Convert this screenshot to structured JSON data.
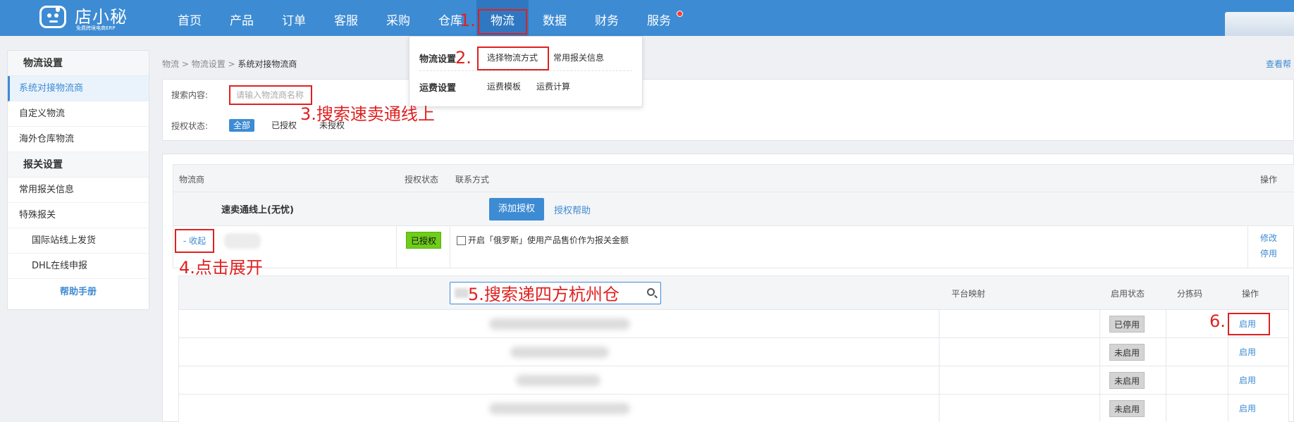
{
  "logo": {
    "title": "店小秘",
    "subtitle": "免费跨境电商ERP"
  },
  "nav": [
    {
      "label": "首页"
    },
    {
      "label": "产品"
    },
    {
      "label": "订单"
    },
    {
      "label": "客服"
    },
    {
      "label": "采购"
    },
    {
      "label": "仓库"
    },
    {
      "label": "物流",
      "active": true
    },
    {
      "label": "数据"
    },
    {
      "label": "财务"
    },
    {
      "label": "服务",
      "has_dot": true
    }
  ],
  "dropdown": {
    "group1_title": "物流设置",
    "group1_items": [
      "选择物流方式",
      "常用报关信息"
    ],
    "group2_title": "运费设置",
    "group2_items": [
      "运费模板",
      "运费计算"
    ]
  },
  "sidebar": {
    "section1": "物流设置",
    "items1": [
      "系统对接物流商",
      "自定义物流",
      "海外仓库物流"
    ],
    "section2": "报关设置",
    "items2": [
      "常用报关信息",
      "特殊报关"
    ],
    "sub_items": [
      "国际站线上发货",
      "DHL在线申报"
    ],
    "help": "帮助手册"
  },
  "breadcrumb": {
    "part1": "物流",
    "sep": " > ",
    "part2": "物流设置",
    "current": "系统对接物流商"
  },
  "help_link": "查看帮",
  "filter": {
    "search_label": "搜索内容:",
    "search_placeholder": "请输入物流商名称",
    "auth_label": "授权状态:",
    "auth_options": [
      "全部",
      "已授权",
      "未授权"
    ]
  },
  "table": {
    "headers": {
      "provider": "物流商",
      "auth_status": "授权状态",
      "contact": "联系方式",
      "action": "操作"
    },
    "provider_name": "速卖通线上(无忧)",
    "add_auth": "添加授权",
    "auth_help": "授权帮助",
    "collapse": "- 收起",
    "authorized": "已授权",
    "checkbox_label": "开启「俄罗斯」使用产品售价作为报关金额",
    "edit": "修改",
    "disable": "停用"
  },
  "sub_table": {
    "headers": {
      "platform_map": "平台映射",
      "enable_state": "启用状态",
      "sort_code": "分拣码",
      "action": "操作"
    },
    "rows": [
      {
        "state": "已停用",
        "action": "启用"
      },
      {
        "state": "未启用",
        "action": "启用"
      },
      {
        "state": "未启用",
        "action": "启用"
      },
      {
        "state": "未启用",
        "action": "启用"
      }
    ]
  },
  "annotations": {
    "a1": "1.",
    "a2": "2.",
    "a3": "3.搜索速卖通线上",
    "a4": "4.点击展开",
    "a5": "5.搜索递四方杭州仓",
    "a6": "6."
  },
  "colors": {
    "brand": "#3d8bd3",
    "annotation": "#e02020",
    "authorized_tag": "#6fcd1b"
  }
}
